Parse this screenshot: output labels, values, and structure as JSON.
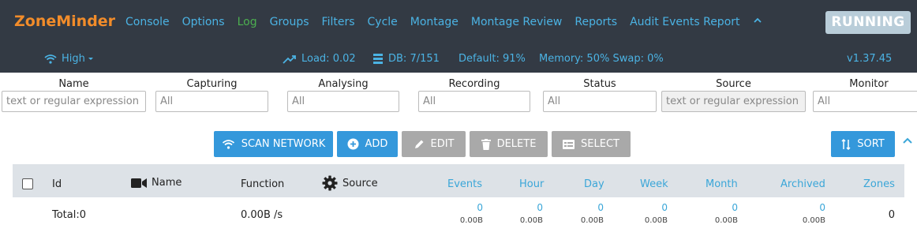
{
  "brand": "ZoneMinder",
  "nav": {
    "items": [
      "Console",
      "Options",
      "Log",
      "Groups",
      "Filters",
      "Cycle",
      "Montage",
      "Montage Review",
      "Reports",
      "Audit Events Report"
    ]
  },
  "status_badge": "RUNNING",
  "statusbar": {
    "bandwidth": "High",
    "load": "Load: 0.02",
    "db": "DB: 7/151",
    "default": "Default: 91%",
    "memory": "Memory: 50% Swap: 0%",
    "version": "v1.37.45"
  },
  "filters": {
    "name": {
      "label": "Name",
      "placeholder": "text or regular expression"
    },
    "capturing": {
      "label": "Capturing",
      "placeholder": "All"
    },
    "analysing": {
      "label": "Analysing",
      "placeholder": "All"
    },
    "recording": {
      "label": "Recording",
      "placeholder": "All"
    },
    "status": {
      "label": "Status",
      "placeholder": "All"
    },
    "source": {
      "label": "Source",
      "placeholder": "text or regular expression"
    },
    "monitor": {
      "label": "Monitor",
      "placeholder": "All"
    }
  },
  "toolbar": {
    "scan": "SCAN NETWORK",
    "add": "ADD",
    "edit": "EDIT",
    "delete": "DELETE",
    "select": "SELECT",
    "sort": "SORT"
  },
  "table": {
    "headers": {
      "id": "Id",
      "name": "Name",
      "function": "Function",
      "source": "Source",
      "events": "Events",
      "hour": "Hour",
      "day": "Day",
      "week": "Week",
      "month": "Month",
      "archived": "Archived",
      "zones": "Zones"
    },
    "totals": {
      "label": "Total:0",
      "function": "0.00B /s",
      "events": {
        "count": "0",
        "size": "0.00B"
      },
      "hour": {
        "count": "0",
        "size": "0.00B"
      },
      "day": {
        "count": "0",
        "size": "0.00B"
      },
      "week": {
        "count": "0",
        "size": "0.00B"
      },
      "month": {
        "count": "0",
        "size": "0.00B"
      },
      "archived": {
        "count": "0",
        "size": "0.00B"
      },
      "zones": "0"
    }
  },
  "colors": {
    "nav_bg": "#333a44",
    "brand": "#f28c2a",
    "link": "#4bb3e4",
    "log": "#4caf50",
    "primary_button": "#3498db",
    "disabled_button": "#a9a9a9",
    "table_header_bg": "#dde2e7"
  }
}
